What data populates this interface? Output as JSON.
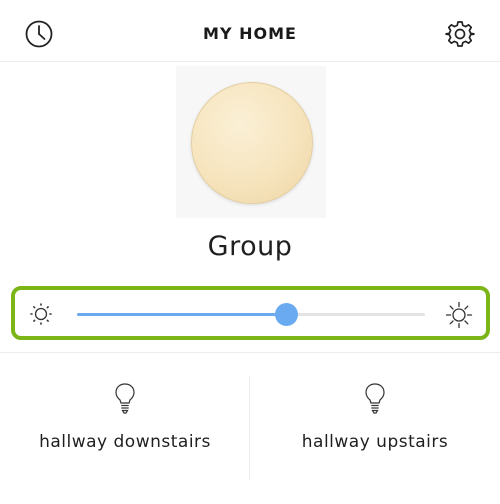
{
  "header": {
    "title": "MY HOME"
  },
  "group": {
    "name": "Group",
    "color": "#f6e4bd"
  },
  "brightness": {
    "level_percent": 60
  },
  "colors": {
    "accent": "#6aaaf0",
    "highlight_border": "#7cb518"
  },
  "icons": {
    "history": "clock-icon",
    "settings": "gear-icon",
    "brightness_low": "sun-dim-icon",
    "brightness_high": "sun-bright-icon",
    "bulb": "lightbulb-icon"
  },
  "bulbs": [
    {
      "label": "hallway downstairs"
    },
    {
      "label": "hallway upstairs"
    }
  ]
}
